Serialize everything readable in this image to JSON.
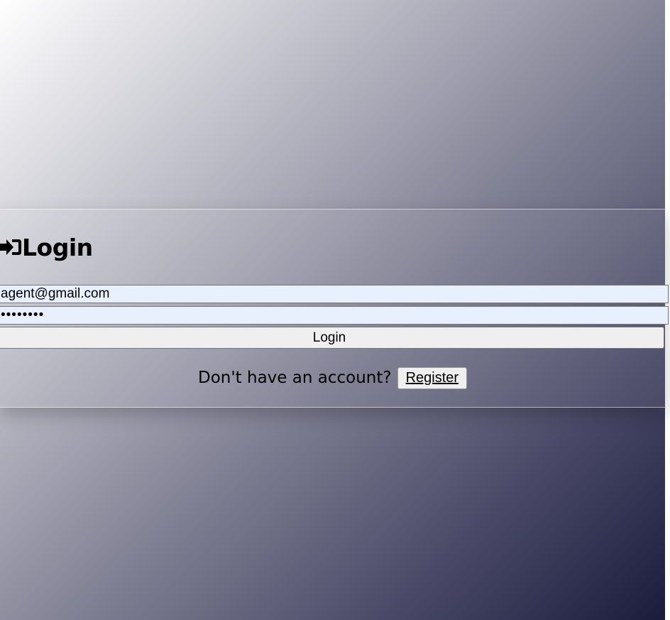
{
  "login_form": {
    "title": "Login",
    "title_icon": "sign-in-icon",
    "email_value": "agent@gmail.com",
    "password_masked": "••••••••",
    "login_button_label": "Login",
    "register_prompt": "Don't have an account?",
    "register_button_label": "Register"
  },
  "colors": {
    "gradient_start": "#ffffff",
    "gradient_end": "#1b1b3c",
    "autofill_field": "#e8f0fe",
    "button_bg": "#efefef"
  }
}
